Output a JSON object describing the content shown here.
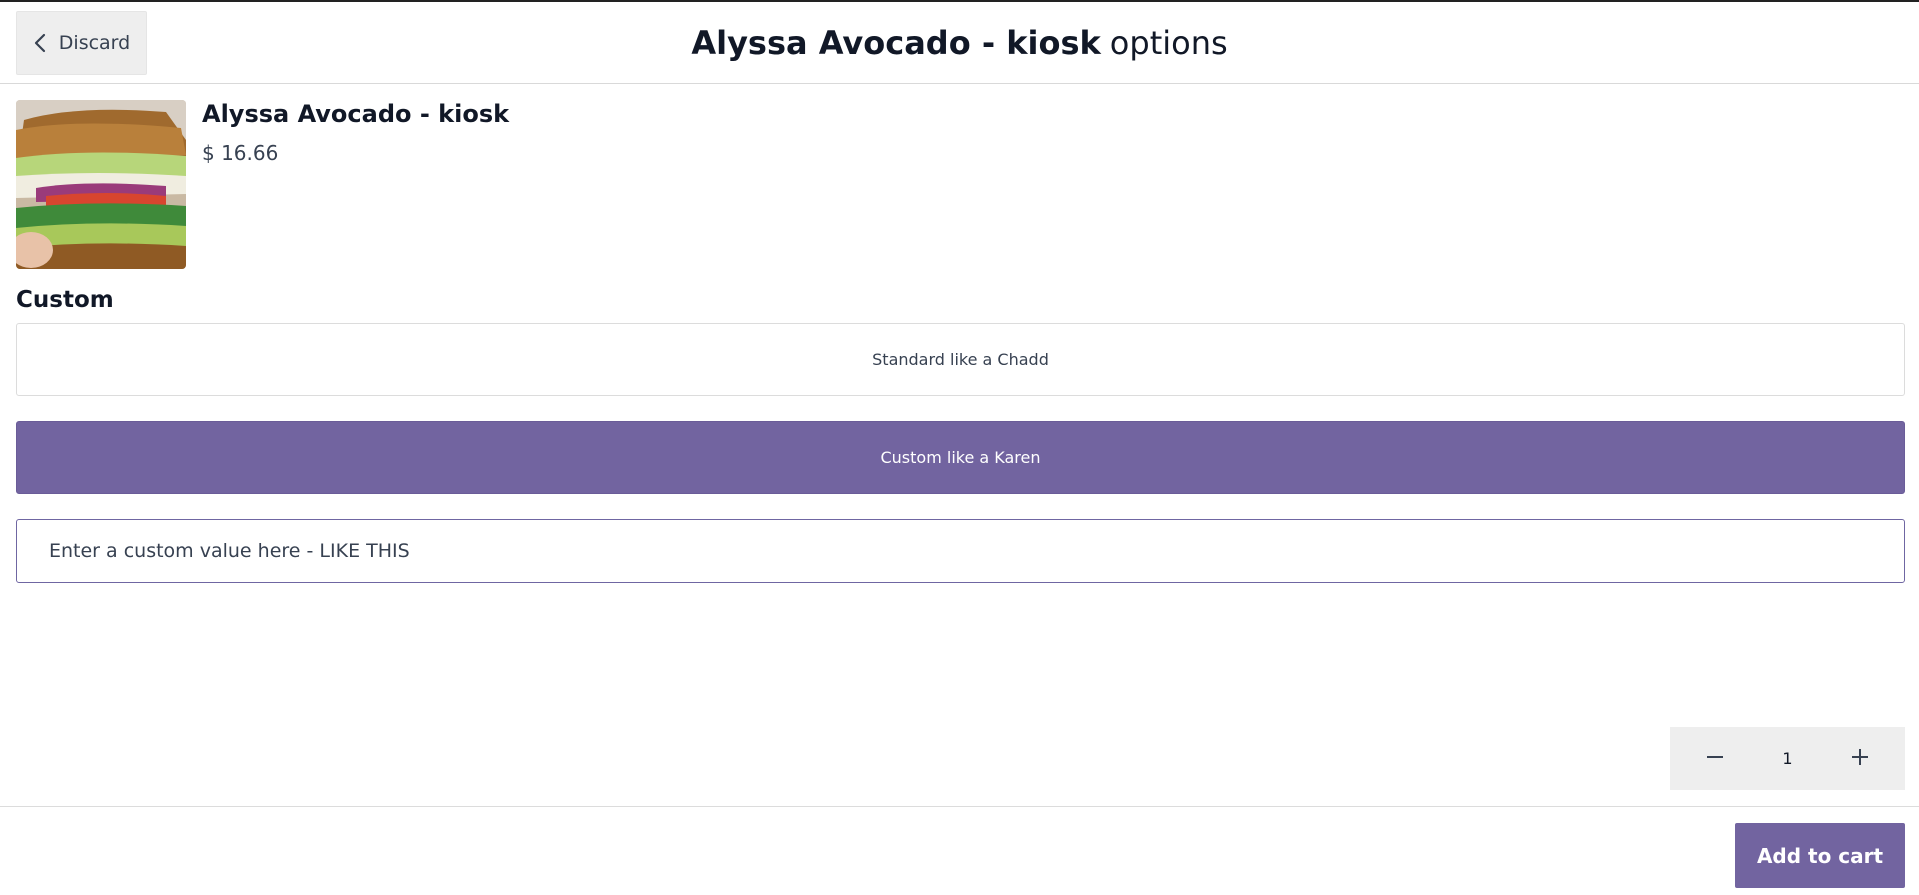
{
  "header": {
    "discard_label": "Discard",
    "title_product": "Alyssa Avocado - kiosk",
    "title_suffix": "options"
  },
  "product": {
    "name": "Alyssa Avocado - kiosk",
    "price": "$ 16.66",
    "image_icon": "sandwich-photo"
  },
  "custom_section": {
    "title": "Custom",
    "options": [
      {
        "label": "Standard like a Chadd",
        "selected": false
      },
      {
        "label": "Custom like a Karen",
        "selected": true
      }
    ],
    "custom_input_value": "Enter a custom value here - LIKE THIS"
  },
  "quantity": {
    "value": "1"
  },
  "footer": {
    "add_to_cart_label": "Add to cart"
  },
  "colors": {
    "accent": "#7264a0",
    "button_grey": "#eeeeee"
  }
}
